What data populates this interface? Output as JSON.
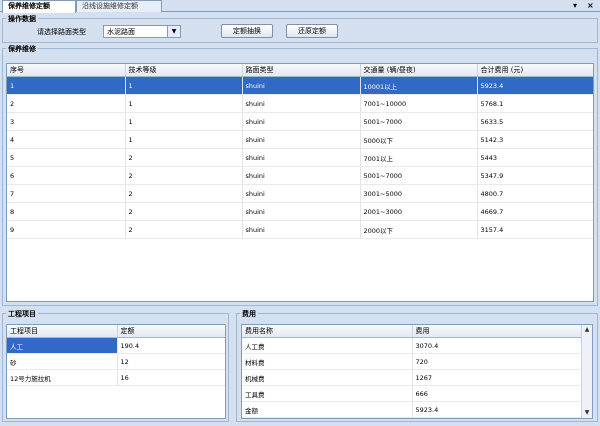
{
  "tabs": [
    {
      "label": "保养维修定额"
    },
    {
      "label": "沿线设施维修定额"
    }
  ],
  "window_controls": {
    "dropdown": "▾",
    "close": "×"
  },
  "operation": {
    "title": "操作数据",
    "road_type_label": "请选择路面类型",
    "road_type_value": "水泥路面",
    "extract_button": "定额抽换",
    "restore_button": "还原定额"
  },
  "maintenance": {
    "title": "保养维修",
    "columns": [
      "序号",
      "技术等级",
      "路面类型",
      "交通量 (辆/昼夜)",
      "合计费用 (元)"
    ],
    "rows": [
      [
        "1",
        "1",
        "shuini",
        "10001以上",
        "5923.4"
      ],
      [
        "2",
        "1",
        "shuini",
        "7001~10000",
        "5768.1"
      ],
      [
        "3",
        "1",
        "shuini",
        "5001~7000",
        "5633.5"
      ],
      [
        "4",
        "1",
        "shuini",
        "5000以下",
        "5142.3"
      ],
      [
        "5",
        "2",
        "shuini",
        "7001以上",
        "5443"
      ],
      [
        "6",
        "2",
        "shuini",
        "5001~7000",
        "5347.9"
      ],
      [
        "7",
        "2",
        "shuini",
        "3001~5000",
        "4800.7"
      ],
      [
        "8",
        "2",
        "shuini",
        "2001~3000",
        "4669.7"
      ],
      [
        "9",
        "2",
        "shuini",
        "2000以下",
        "3157.4"
      ]
    ],
    "selected_row": 0
  },
  "projects": {
    "title": "工程项目",
    "columns": [
      "工程项目",
      "定额"
    ],
    "rows": [
      [
        "人工",
        "190.4"
      ],
      [
        "砂",
        "12"
      ],
      [
        "12号力施拉机",
        "16"
      ]
    ],
    "selected_row": 0
  },
  "costs": {
    "title": "费用",
    "columns": [
      "费用名称",
      "费用"
    ],
    "rows": [
      [
        "人工费",
        "3070.4"
      ],
      [
        "材料费",
        "720"
      ],
      [
        "机械费",
        "1267"
      ],
      [
        "工具费",
        "666"
      ],
      [
        "金额",
        "5923.4"
      ]
    ]
  }
}
